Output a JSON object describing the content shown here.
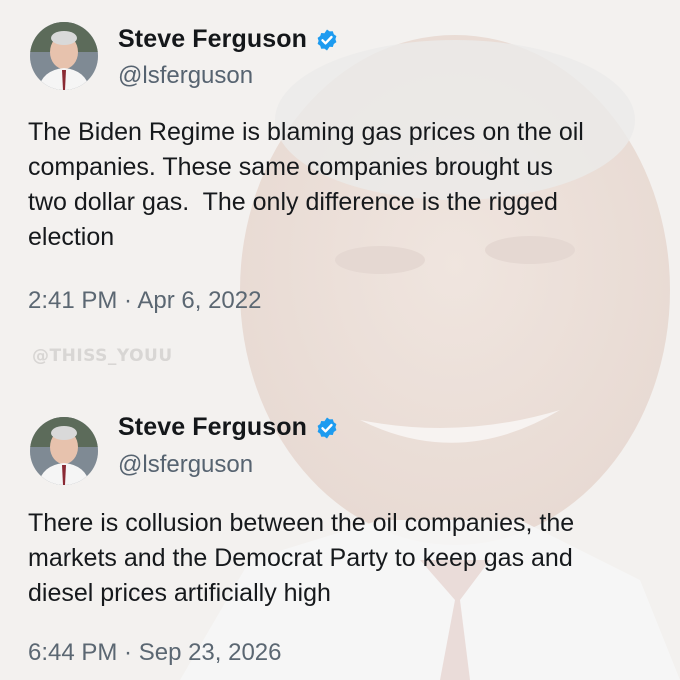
{
  "tweets": [
    {
      "name": "Steve Ferguson",
      "handle": "@lsferguson",
      "text": "The Biden Regime is blaming gas prices on the oil\ncompanies. These same companies brought us\ntwo dollar gas.  The only difference is the rigged\nelection",
      "timestamp": "2:41 PM · Apr 6, 2022",
      "verified_icon": "verified-badge-icon",
      "avatar": "profile-photo"
    },
    {
      "name": "Steve Ferguson",
      "handle": "@lsferguson",
      "text": "There is collusion between the oil companies, the\nmarkets and the Democrat Party to keep gas and\ndiesel prices artificially high",
      "timestamp": "6:44 PM · Sep 23, 2026",
      "verified_icon": "verified-badge-icon",
      "avatar": "profile-photo"
    }
  ],
  "watermark": "@THISS_YOUU",
  "colors": {
    "verified": "#1d9bf0",
    "name": "#14171a",
    "secondary": "#566370",
    "background": "#f2f0ee"
  }
}
